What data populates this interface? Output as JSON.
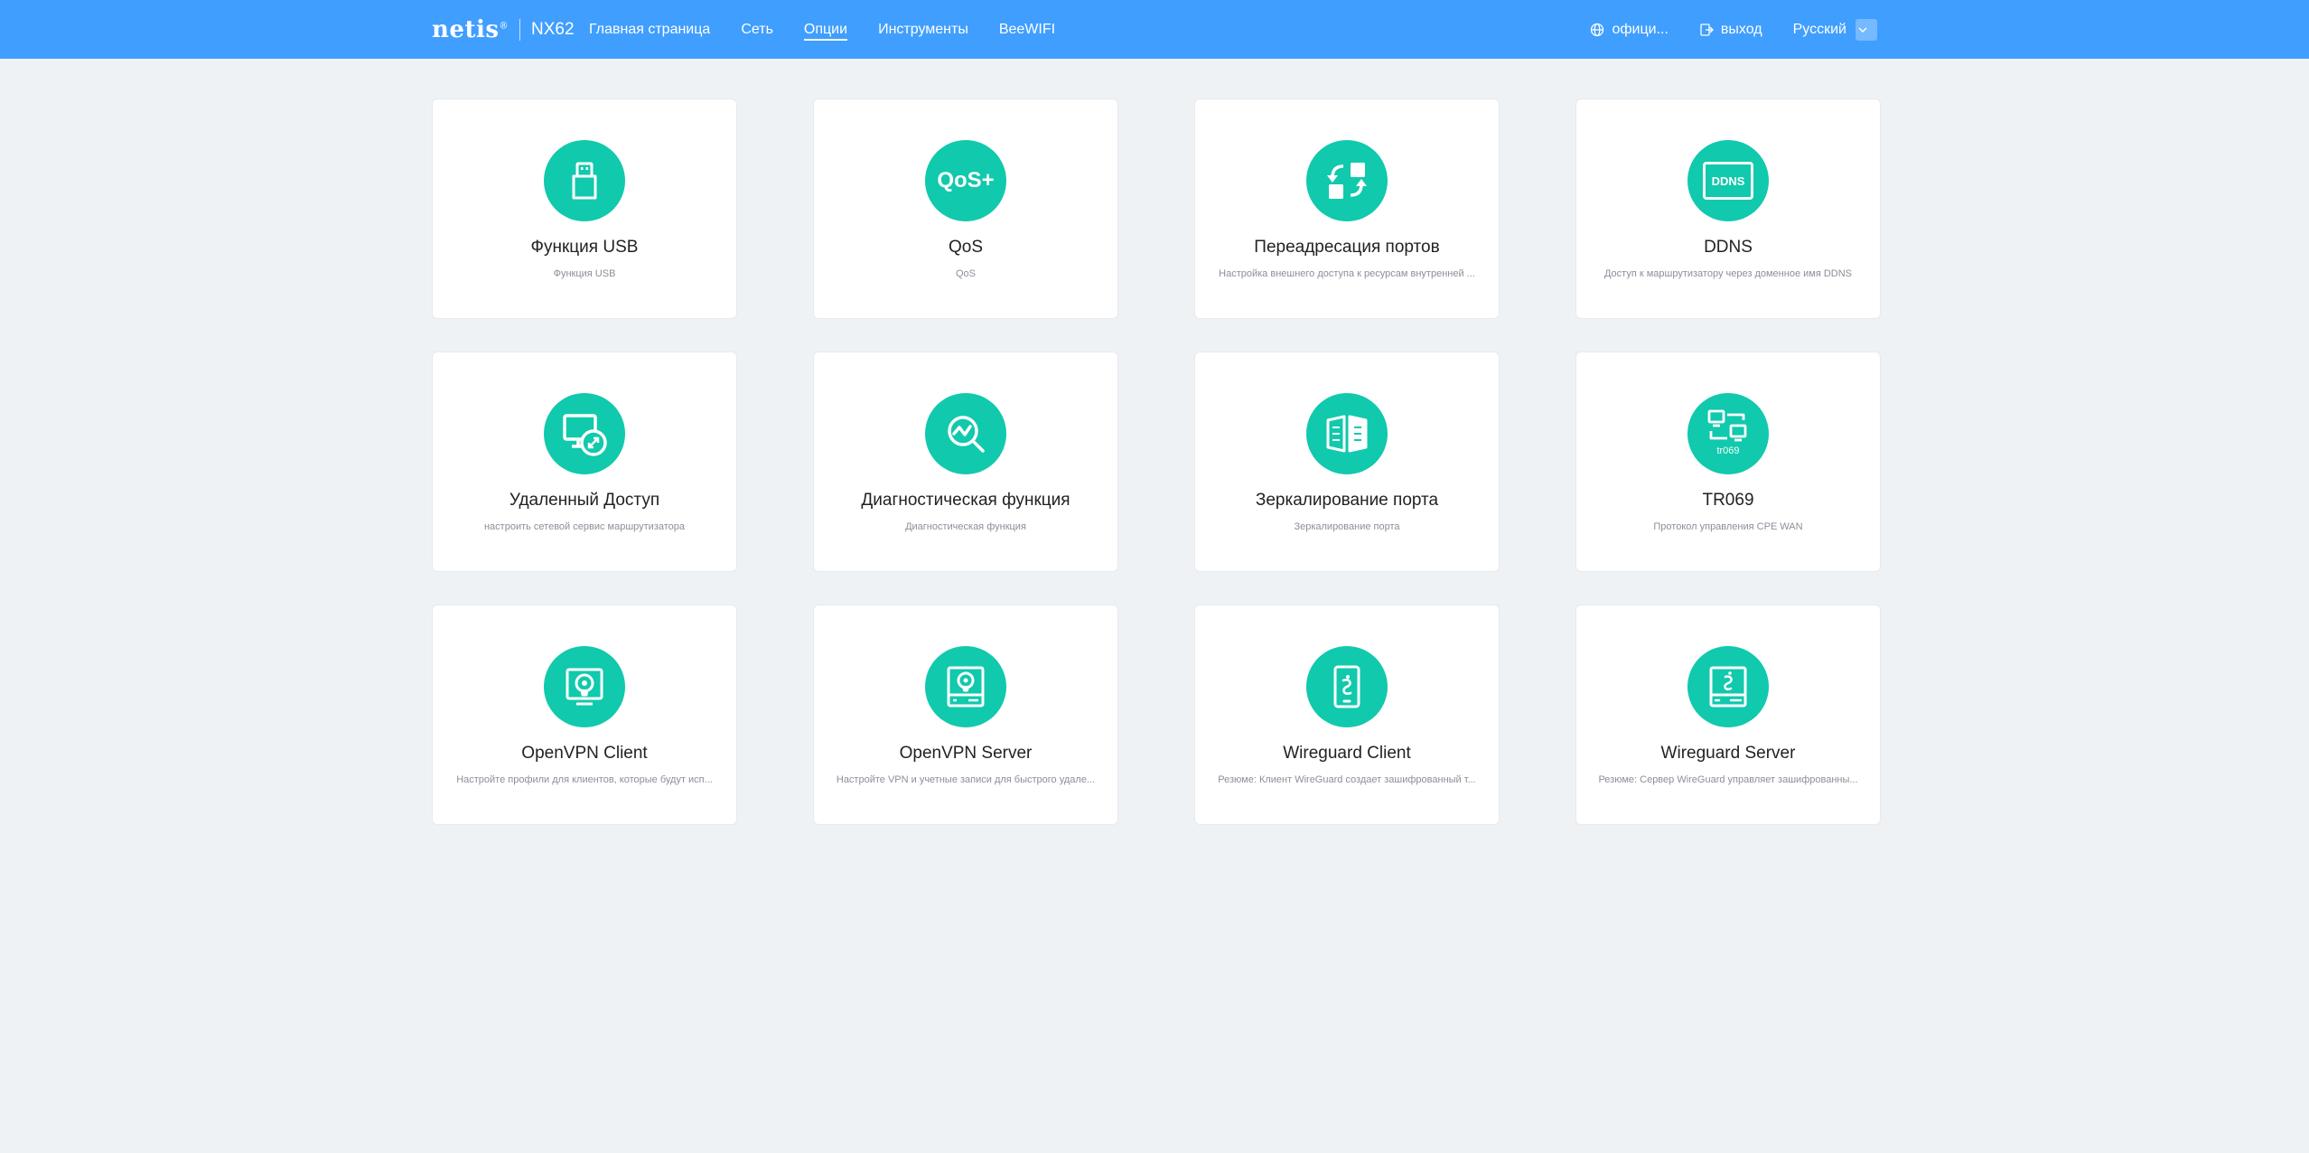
{
  "header": {
    "brand": "netis",
    "model": "NX62",
    "nav": [
      {
        "label": "Главная страница"
      },
      {
        "label": "Сеть"
      },
      {
        "label": "Опции"
      },
      {
        "label": "Инструменты"
      },
      {
        "label": "BeeWIFI"
      }
    ],
    "active_nav": "Опции",
    "official_label": "офици...",
    "logout_label": "выход",
    "language": "Русский"
  },
  "cards": [
    {
      "title": "Функция USB",
      "desc": "Функция USB",
      "icon": "usb-icon"
    },
    {
      "title": "QoS",
      "desc": "QoS",
      "icon": "qos-icon",
      "icon_text": "QoS+"
    },
    {
      "title": "Переадресация портов",
      "desc": "Настройка внешнего доступа к ресурсам внутренней ...",
      "icon": "port-forwarding-icon"
    },
    {
      "title": "DDNS",
      "desc": "Доступ к маршрутизатору через доменное имя DDNS",
      "icon": "ddns-icon",
      "icon_text": "DDNS"
    },
    {
      "title": "Удаленный Доступ",
      "desc": "настроить сетевой сервис маршрутизатора",
      "icon": "remote-access-icon"
    },
    {
      "title": "Диагностическая функция",
      "desc": "Диагностическая функция",
      "icon": "diagnostics-icon"
    },
    {
      "title": "Зеркалирование порта",
      "desc": "Зеркалирование порта",
      "icon": "port-mirroring-icon"
    },
    {
      "title": "TR069",
      "desc": "Протокол управления CPE WAN",
      "icon": "tr069-icon",
      "icon_text": "tr069"
    },
    {
      "title": "OpenVPN Client",
      "desc": "Настройте профили для клиентов, которые будут исп...",
      "icon": "openvpn-client-icon"
    },
    {
      "title": "OpenVPN Server",
      "desc": "Настройте VPN и учетные записи для быстрого удале...",
      "icon": "openvpn-server-icon"
    },
    {
      "title": "Wireguard Client",
      "desc": "Резюме: Клиент WireGuard создает зашифрованный т...",
      "icon": "wireguard-client-icon"
    },
    {
      "title": "Wireguard Server",
      "desc": "Резюме: Сервер WireGuard управляет зашифрованны...",
      "icon": "wireguard-server-icon"
    }
  ],
  "colors": {
    "topbar": "#409eff",
    "accent": "#11c9ad",
    "background": "#eff2f5"
  }
}
